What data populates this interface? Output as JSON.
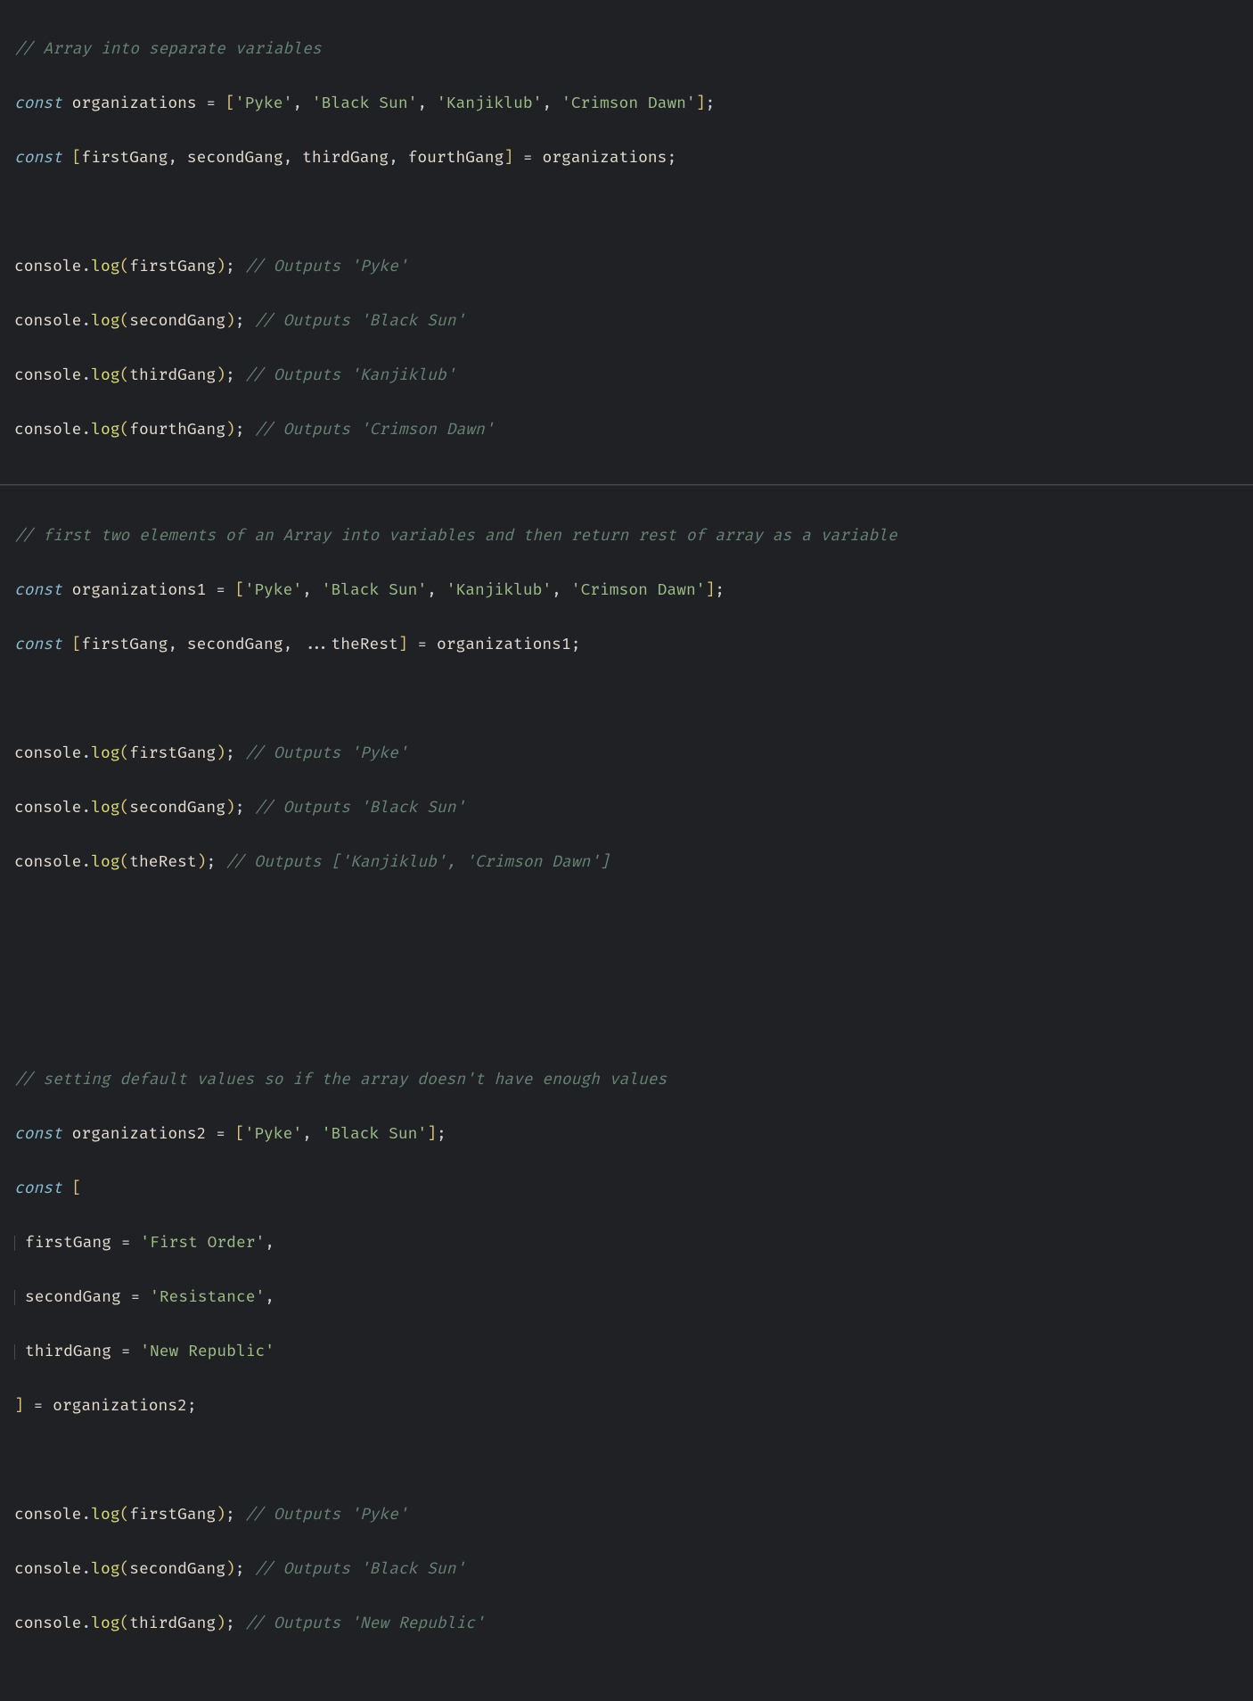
{
  "colors": {
    "bg": "#1f2125",
    "comment": "#688374",
    "keyword": "#8bbdd1",
    "identifier": "#e6ddd0",
    "bracket": "#e0c87a",
    "string": "#9fbf89",
    "property": "#dede7a"
  },
  "b1": {
    "c0": "// Array into separate variables",
    "kw": "const",
    "v0": "organizations",
    "eq": " = ",
    "lbr": "[",
    "rbr": "]",
    "sPyke": "'Pyke'",
    "sBlackSun": "'Black Sun'",
    "sKanjiklub": "'Kanjiklub'",
    "sCrimsonDawn": "'Crimson Dawn'",
    "comma": ", ",
    "semi": ";",
    "v1": "firstGang",
    "v2": "secondGang",
    "v3": "thirdGang",
    "v4": "fourthGang",
    "cons": "console",
    "dot": ".",
    "log": "log",
    "lp": "(",
    "rp": ")",
    "cOutPyke": "// Outputs 'Pyke'",
    "cOutBlack": "// Outputs 'Black Sun'",
    "cOutKanji": "// Outputs 'Kanjiklub'",
    "cOutCrimson": "// Outputs 'Crimson Dawn'"
  },
  "b2": {
    "c0": "// first two elements of an Array into variables and then return rest of array as a variable",
    "kw": "const",
    "v0": "organizations1",
    "eq": " = ",
    "lbr": "[",
    "rbr": "]",
    "sPyke": "'Pyke'",
    "sBlackSun": "'Black Sun'",
    "sKanjiklub": "'Kanjiklub'",
    "sCrimsonDawn": "'Crimson Dawn'",
    "comma": ", ",
    "semi": ";",
    "v1": "firstGang",
    "v2": "secondGang",
    "spread": "...",
    "v3": "theRest",
    "cons": "console",
    "dot": ".",
    "log": "log",
    "lp": "(",
    "rp": ")",
    "cOutPyke": "// Outputs 'Pyke'",
    "cOutBlack": "// Outputs 'Black Sun'",
    "cOutRest": "// Outputs ['Kanjiklub', 'Crimson Dawn']"
  },
  "b3": {
    "c0": "// setting default values so if the array doesn't have enough values",
    "kw": "const",
    "v0": "organizations2",
    "eq": " = ",
    "lbr": "[",
    "rbr": "]",
    "sPyke": "'Pyke'",
    "sBlackSun": "'Black Sun'",
    "sFirstOrder": "'First Order'",
    "sResistance": "'Resistance'",
    "sNewRepublic": "'New Republic'",
    "comma": ", ",
    "commaEnd": ",",
    "semi": ";",
    "v1": "firstGang",
    "v2": "secondGang",
    "v3": "thirdGang",
    "cons": "console",
    "dot": ".",
    "log": "log",
    "lp": "(",
    "rp": ")",
    "cOutPyke": "// Outputs 'Pyke'",
    "cOutBlack": "// Outputs 'Black Sun'",
    "cOutNewRep": "// Outputs 'New Republic'"
  }
}
